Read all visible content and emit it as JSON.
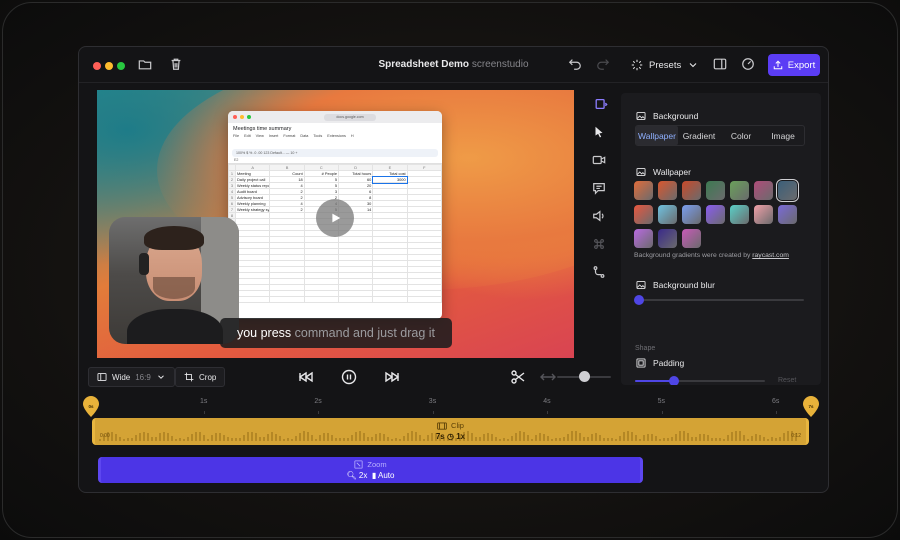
{
  "titlebar": {
    "doc_title": "Spreadsheet Demo",
    "app_name": "screenstudio",
    "presets_label": "Presets",
    "export_label": "Export"
  },
  "canvas": {
    "caption_spoken": "you press",
    "caption_pending": "command and just drag it",
    "browser": {
      "url": "docs.google.com",
      "sheet_title": "Meetings time summary",
      "menu": [
        "File",
        "Edit",
        "View",
        "Insert",
        "Format",
        "Data",
        "Tools",
        "Extensions",
        "H"
      ],
      "toolbar_text": "100%   $  %  .0  .00  123   Default...   —  10  +",
      "formula_cell": "E2",
      "columns": [
        "",
        "A",
        "B",
        "C",
        "D",
        "E",
        "F"
      ],
      "header_row": [
        "Meeting",
        "Count",
        "# People",
        "Total hours",
        "Total cost",
        ""
      ],
      "rows": [
        [
          "Daily project call",
          "18",
          "5",
          "60",
          "3000",
          ""
        ],
        [
          "Weekly status report",
          "4",
          "5",
          "20",
          "",
          ""
        ],
        [
          "Audit board",
          "2",
          "3",
          "6",
          "",
          ""
        ],
        [
          "Advisory board",
          "2",
          "2",
          "8",
          "",
          ""
        ],
        [
          "Weekly planning",
          "4",
          "4",
          "30",
          "",
          ""
        ],
        [
          "Weekly strategy sync",
          "2",
          "5",
          "14",
          "",
          ""
        ],
        [
          "",
          "",
          "",
          "",
          "",
          ""
        ],
        [
          "",
          "",
          "",
          "",
          "",
          ""
        ],
        [
          "",
          "",
          "",
          "",
          "",
          ""
        ],
        [
          "",
          "",
          "",
          "",
          "",
          ""
        ],
        [
          "",
          "",
          "",
          "",
          "",
          ""
        ],
        [
          "",
          "",
          "",
          "",
          "",
          ""
        ],
        [
          "",
          "",
          "",
          "",
          "",
          ""
        ],
        [
          "",
          "",
          "",
          "",
          "",
          ""
        ],
        [
          "",
          "",
          "",
          "",
          "",
          ""
        ],
        [
          "",
          "",
          "",
          "",
          "",
          ""
        ],
        [
          "",
          "",
          "",
          "",
          "",
          ""
        ],
        [
          "",
          "",
          "",
          "",
          "",
          ""
        ],
        [
          "",
          "",
          "",
          "",
          "",
          ""
        ],
        [
          "",
          "",
          "",
          "",
          "",
          ""
        ],
        [
          "",
          "",
          "",
          "",
          "",
          ""
        ]
      ]
    }
  },
  "panel": {
    "background_label": "Background",
    "tabs": [
      "Wallpaper",
      "Gradient",
      "Color",
      "Image"
    ],
    "active_tab": "Wallpaper",
    "wallpaper_label": "Wallpaper",
    "swatches": [
      [
        "#e06c3b",
        "#d9572f",
        "#c94a2a",
        "#3d7a52",
        "#6aa05a",
        "#b04c7a",
        "#3b5f7a"
      ],
      [
        "#e8573f",
        "#6fc2e0",
        "#7a9ef0",
        "#8a5cf0",
        "#5ad0c8",
        "#f0a0a8",
        "#7a6ad8"
      ],
      [
        "#b86ae0",
        "#3a2a8a",
        "#c85ab8"
      ]
    ],
    "credit_text": "Background gradients were created by",
    "credit_link": "raycast.com",
    "background_blur_label": "Background blur",
    "background_blur_value": 0,
    "shape_label": "Shape",
    "padding_label": "Padding",
    "padding_value": 0.3,
    "reset_label": "Reset"
  },
  "controls": {
    "aspect_label": "Wide",
    "aspect_ratio": "16:9",
    "crop_label": "Crop",
    "zoom_slider_value": 0.5
  },
  "timeline": {
    "ruler": [
      "1s",
      "2s",
      "3s",
      "4s",
      "5s",
      "6s"
    ],
    "start_marker": "0s",
    "end_marker": "7s",
    "clip": {
      "label": "Clip",
      "duration": "7s",
      "speed": "1x",
      "start_time": "0:00",
      "end_time": "0:12"
    },
    "zoom": {
      "label": "Zoom",
      "level": "2x",
      "mode": "Auto"
    }
  },
  "colors": {
    "accent": "#5b3df5",
    "clip": "#d4a335",
    "zoom": "#4c35e6",
    "panel_bg": "#1b1b1e"
  }
}
